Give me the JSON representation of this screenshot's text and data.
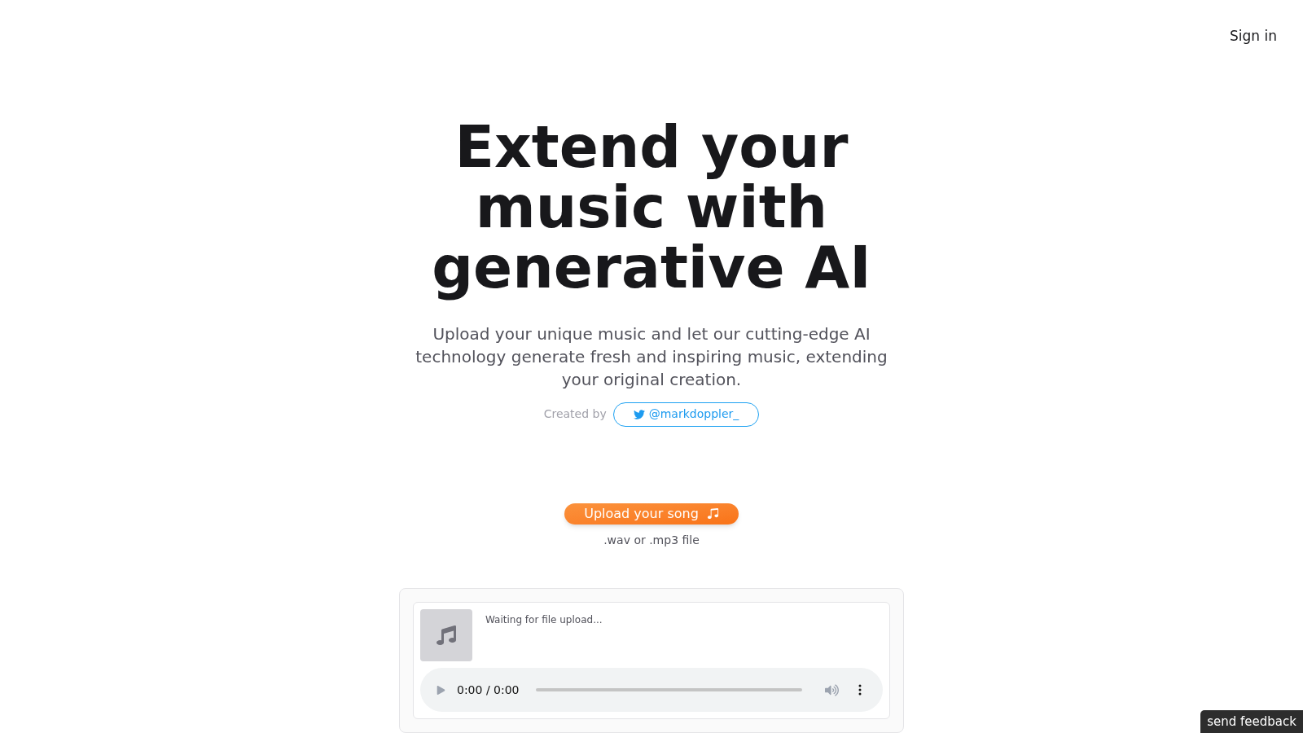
{
  "header": {
    "sign_in": "Sign in"
  },
  "hero": {
    "title": "Extend your music with generative AI",
    "subtitle": "Upload your unique music and let our cutting-edge AI technology generate fresh and inspiring music, extending your original creation.",
    "created_by": "Created by",
    "author_link": "@markdoppler_"
  },
  "upload": {
    "button": "Upload your song",
    "hint": ".wav or .mp3 file"
  },
  "player": {
    "status": "Waiting for file upload...",
    "time": "0:00 / 0:00"
  },
  "feedback": "send feedback"
}
